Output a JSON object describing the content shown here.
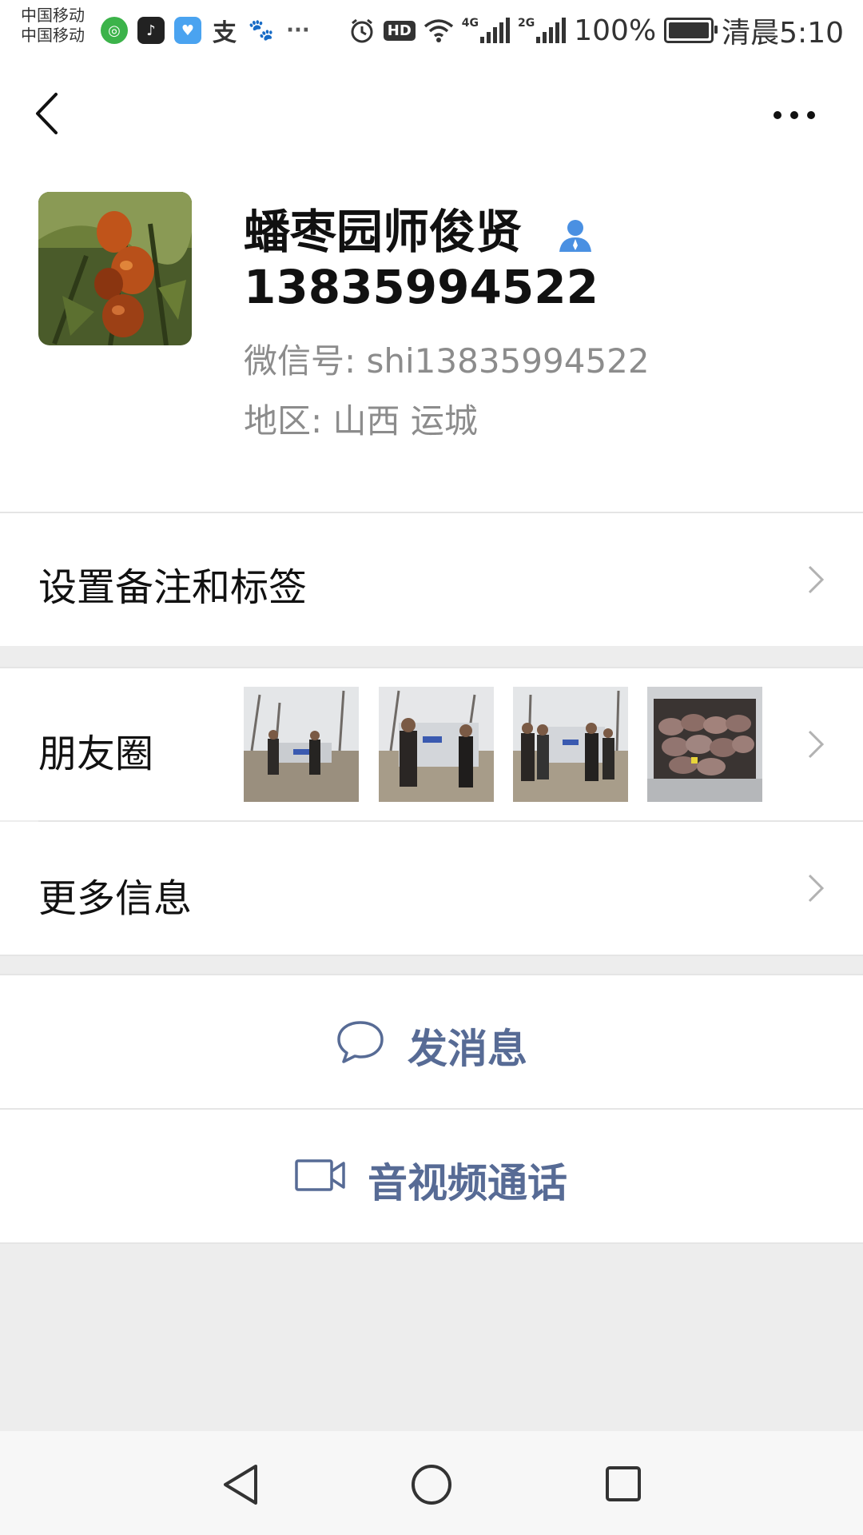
{
  "status_bar": {
    "carrier_1": "中国移动",
    "carrier_2": "中国移动",
    "network_4g": "4G",
    "network_2g": "2G",
    "battery": "100%",
    "time": "清晨5:10",
    "icons": [
      "clock-icon",
      "hd-icon",
      "wifi-icon",
      "signal-icon",
      "battery-icon"
    ],
    "app_icons": [
      "green-app-icon",
      "tiktok-icon",
      "blue-app-icon",
      "alipay-icon",
      "baidu-icon",
      "more-dots-icon"
    ]
  },
  "header": {
    "back_icon": "back-chevron-icon",
    "more_icon": "more-horizontal-icon"
  },
  "profile": {
    "name": "蟠枣园师俊贤",
    "phone": "13835994522",
    "wechat_id": "微信号: shi13835994522",
    "region": "地区: 山西  运城",
    "badge_icon": "person-icon",
    "badge_color": "#4a90e2"
  },
  "menu": {
    "remark_label": "设置备注和标签",
    "moments_label": "朋友圈",
    "more_info_label": "更多信息"
  },
  "actions": {
    "message_label": "发消息",
    "call_label": "音视频通话",
    "accent_color": "#576b95"
  }
}
